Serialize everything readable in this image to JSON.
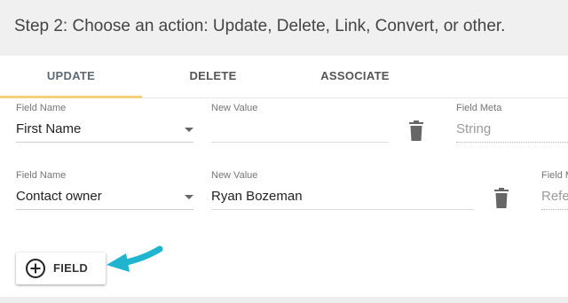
{
  "header": {
    "title": "Step 2: Choose an action: Update, Delete, Link, Convert, or other."
  },
  "tabs": [
    {
      "label": "UPDATE",
      "active": true
    },
    {
      "label": "DELETE",
      "active": false
    },
    {
      "label": "ASSOCIATE",
      "active": false
    }
  ],
  "rows": [
    {
      "field_name_label": "Field Name",
      "field_name_value": "First Name",
      "new_value_label": "New Value",
      "new_value_value": "",
      "field_meta_label": "Field Meta",
      "field_meta_value": "String"
    },
    {
      "field_name_label": "Field Name",
      "field_name_value": "Contact owner",
      "new_value_label": "New Value",
      "new_value_value": "Ryan Bozeman",
      "field_meta_label": "Field Meta",
      "field_meta_value": "Reference"
    }
  ],
  "add_button": {
    "label": "FIELD",
    "icon": "add-circle-icon"
  },
  "colors": {
    "active_tab_indicator": "#f3d37a",
    "pointer_arrow": "#1fb5cf",
    "header_background": "#f0f0f0"
  }
}
